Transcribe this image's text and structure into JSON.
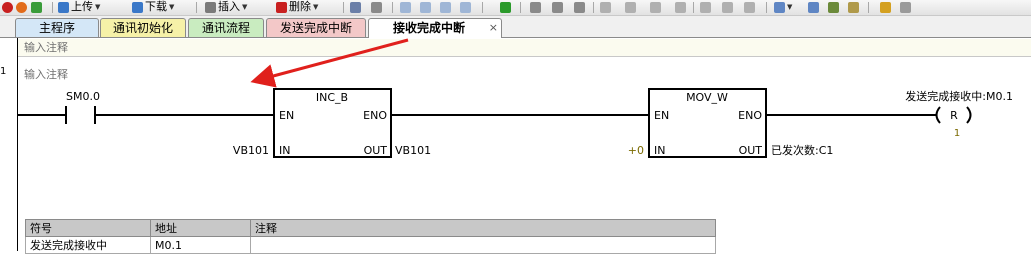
{
  "toolbar": {
    "upload_label": "上传",
    "download_label": "下载",
    "insert_label": "插入",
    "delete_label": "删除"
  },
  "tabs": [
    {
      "label": "主程序",
      "color": "#d4e7f7"
    },
    {
      "label": "通讯初始化",
      "color": "#f6f1a8"
    },
    {
      "label": "通讯流程",
      "color": "#c9ecc0"
    },
    {
      "label": "发送完成中断",
      "color": "#f3c8c8"
    },
    {
      "label": "接收完成中断",
      "color": "#ffffff",
      "active": true
    }
  ],
  "tab_close_glyph": "×",
  "program_comment": "输入注释",
  "network": {
    "number": "1",
    "comment": "输入注释",
    "contact": {
      "operand": "SM0.0"
    },
    "inc_block": {
      "name": "INC_B",
      "en": "EN",
      "eno": "ENO",
      "in": "IN",
      "out": "OUT",
      "in_operand": "VB101",
      "out_operand": "VB101"
    },
    "mov_block": {
      "name": "MOV_W",
      "en": "EN",
      "eno": "ENO",
      "in": "IN",
      "out": "OUT",
      "in_operand": "+0",
      "out_operand": "已发次数:C1"
    },
    "coil": {
      "operand": "发送完成接收中:M0.1",
      "type": "R",
      "count": "1"
    }
  },
  "annotation_arrow_color": "#e0201c",
  "symbol_table": {
    "headers": [
      "符号",
      "地址",
      "注释"
    ],
    "rows": [
      [
        "发送完成接收中",
        "M0.1",
        ""
      ]
    ]
  }
}
